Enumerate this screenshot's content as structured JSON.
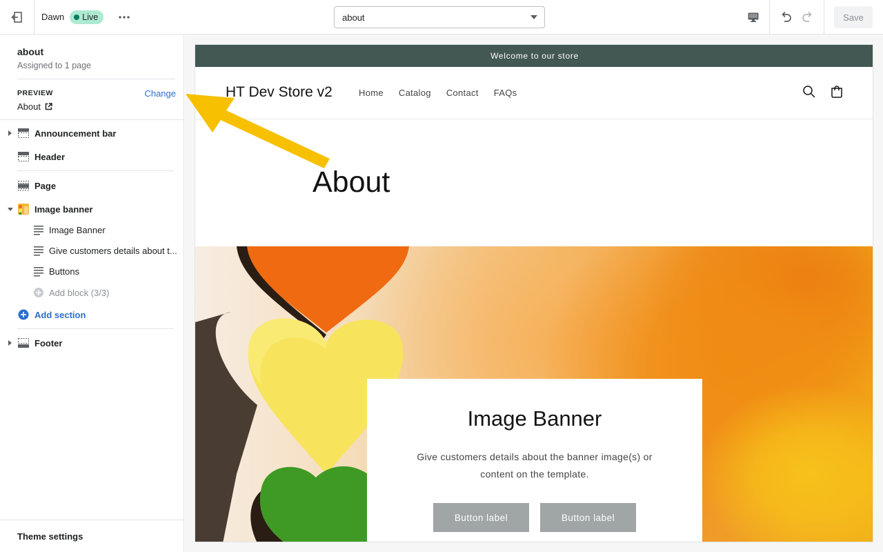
{
  "topbar": {
    "theme_name": "Dawn",
    "live_badge": "Live",
    "page_select_value": "about",
    "save_label": "Save"
  },
  "sidebar": {
    "template_title": "about",
    "template_sub": "Assigned to 1 page",
    "preview_label": "PREVIEW",
    "change_label": "Change",
    "preview_page": "About",
    "sections": {
      "announcement_bar": "Announcement bar",
      "header": "Header",
      "page": "Page",
      "image_banner": "Image banner",
      "block_image_banner": "Image Banner",
      "block_details": "Give customers details about t...",
      "block_buttons": "Buttons",
      "add_block": "Add block (3/3)",
      "add_section": "Add section",
      "footer": "Footer"
    },
    "theme_settings": "Theme settings"
  },
  "store": {
    "announcement": "Welcome to our store",
    "name": "HT Dev Store v2",
    "nav": [
      "Home",
      "Catalog",
      "Contact",
      "FAQs"
    ],
    "page_heading": "About",
    "banner": {
      "title": "Image Banner",
      "text": "Give customers details about the banner image(s) or content on the template.",
      "button1": "Button label",
      "button2": "Button label"
    }
  },
  "colors": {
    "announcement_bg": "#435753",
    "link": "#2c6ecb",
    "live_badge_bg": "#aee9d1",
    "annotation_arrow": "#f7c000",
    "banner_button_bg": "#a0a6a5"
  }
}
